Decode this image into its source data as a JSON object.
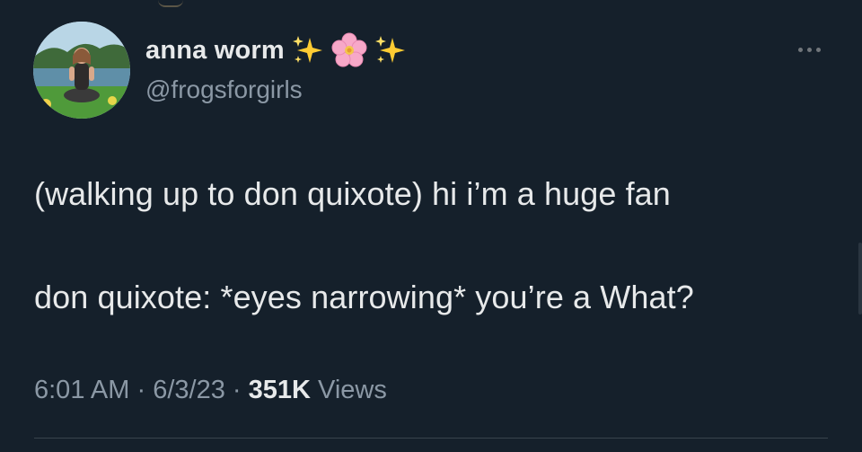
{
  "author": {
    "display_name": "anna worm",
    "handle": "@frogsforgirls",
    "avatar_icon": "profile-photo-avatar",
    "name_emojis": [
      "sparkles-emoji",
      "cherry-blossom-emoji",
      "sparkles-emoji"
    ]
  },
  "tweet": {
    "lines": [
      "(walking up to don quixote) hi i’m a huge fan",
      "don quixote: *eyes narrowing* you’re a What?"
    ]
  },
  "meta": {
    "time": "6:01 AM",
    "separator": "·",
    "date": "6/3/23",
    "views_count": "351K",
    "views_label": "Views"
  },
  "colors": {
    "background": "#15202b",
    "text_primary": "#e7e9ea",
    "text_secondary": "#8b98a5",
    "divider": "#38444d"
  }
}
